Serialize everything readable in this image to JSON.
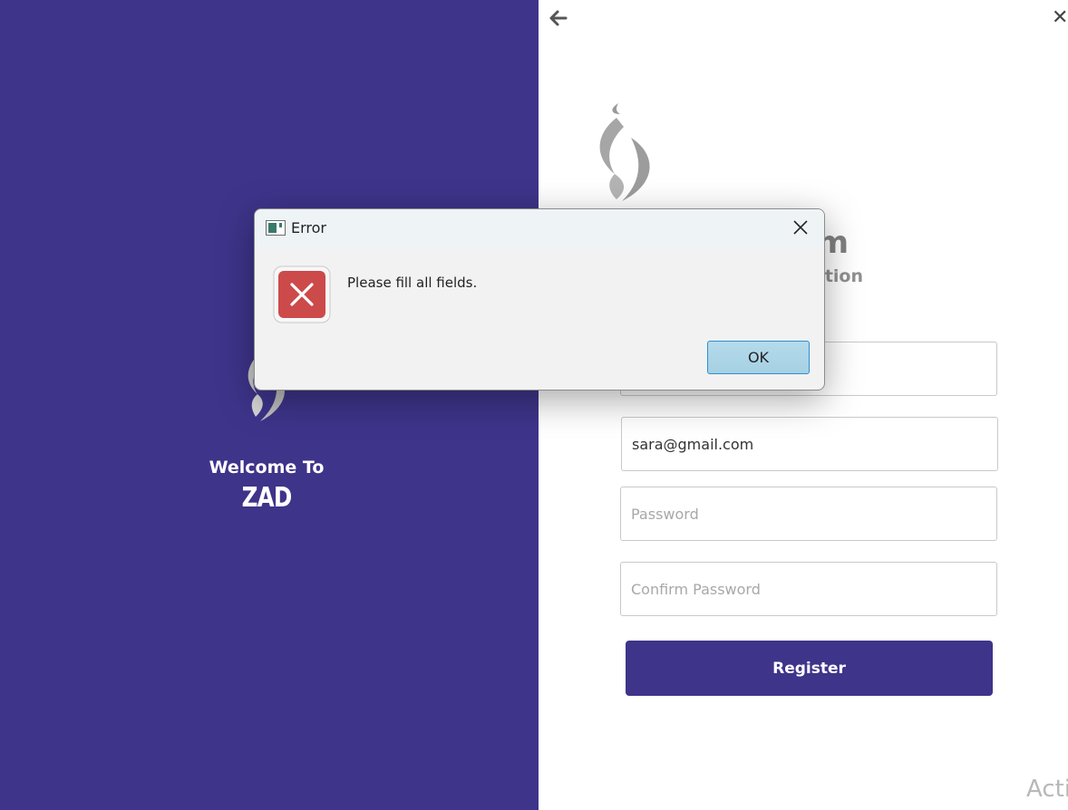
{
  "left": {
    "welcome": "Welcome To",
    "brand": "ZAD"
  },
  "form": {
    "title_fragment": "m",
    "subtitle_fragment": "ation",
    "name_value": "",
    "email_value": "sara@gmail.com",
    "password_placeholder": "Password",
    "confirm_placeholder": "Confirm Password",
    "register_label": "Register"
  },
  "dialog": {
    "title": "Error",
    "message": "Please fill all fields.",
    "ok_label": "OK"
  },
  "icons": {
    "back": "arrow-left-icon",
    "close_app": "close-icon",
    "dialog_close": "close-icon",
    "error": "error-x-icon",
    "logo": "flame-logo"
  },
  "watermark": "Acti",
  "colors": {
    "primary": "#3e348a",
    "error_red": "#c94040",
    "ok_blue": "#2f8fcf"
  }
}
